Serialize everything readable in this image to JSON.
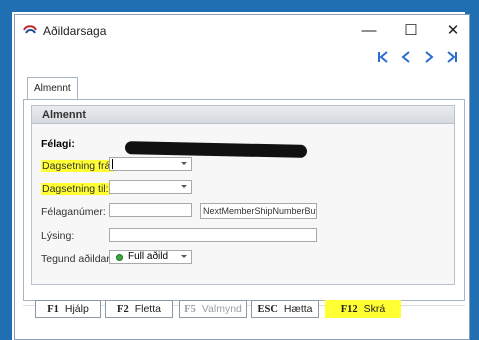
{
  "window": {
    "title": "Aðildarsaga"
  },
  "titlebar": {
    "minimize": "—",
    "maximize": "☐",
    "close": "✕"
  },
  "tabs": [
    {
      "label": "Almennt"
    }
  ],
  "group": {
    "title": "Almennt"
  },
  "fields": {
    "felagi_label": "Félagi:",
    "dags_fra_label": "Dagsetning frá:",
    "dags_til_label": "Dagsetning til:",
    "felaganumer_label": "Félaganúmer:",
    "next_button": "NextMemberShipNumberButt",
    "lysing_label": "Lýsing:",
    "tegund_label": "Tegund aðildar:",
    "tegund_value": "Full aðild"
  },
  "footer": {
    "help_key": "F1",
    "help_label": "Hjálp",
    "delete_key": "F2",
    "delete_label": "Fletta",
    "view_key": "F5",
    "view_label": "Valmynd",
    "cancel_key": "ESC",
    "cancel_label": "Hætta",
    "save_key": "F12",
    "save_label": "Skrá"
  },
  "colors": {
    "accent": "#1f6fb2",
    "highlight": "#ffff33",
    "status_ok": "#3aa93a"
  }
}
